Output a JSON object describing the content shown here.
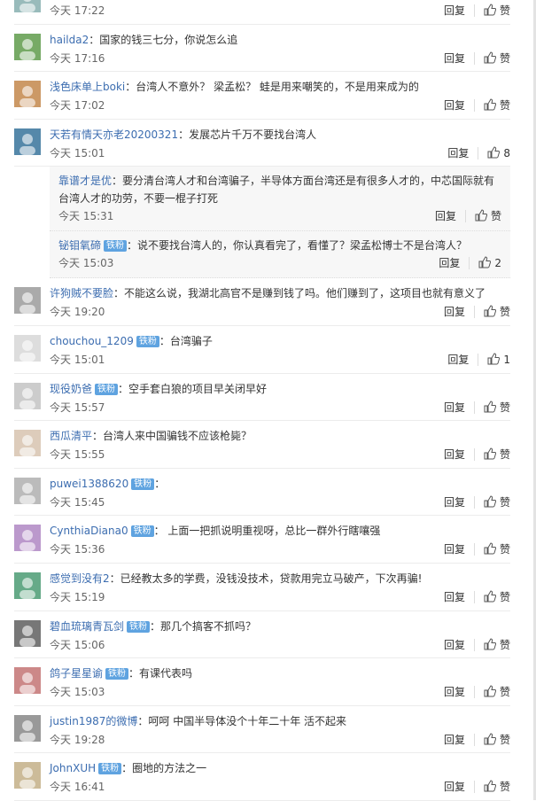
{
  "ui": {
    "reply_label": "回复",
    "like_label": "赞"
  },
  "comments": [
    {
      "user": "",
      "badge": "",
      "text": "",
      "time": "今天 17:22",
      "likes": ""
    },
    {
      "user": "hailda2",
      "badge": "",
      "text": "：国家的钱三七分，你说怎么追",
      "time": "今天 17:16",
      "likes": ""
    },
    {
      "user": "浅色床单上boki",
      "badge": "",
      "text": "：台湾人不意外？ 梁孟松？ 蛙是用来嘲笑的，不是用来成为的",
      "time": "今天 17:02",
      "likes": ""
    },
    {
      "user": "天若有情天亦老20200321",
      "badge": "",
      "text": "：发展芯片千万不要找台湾人",
      "time": "今天 15:01",
      "likes": "8"
    },
    {
      "user": "许狗贼不要脸",
      "badge": "",
      "text": "：不能这么说，我湖北高官不是赚到钱了吗。他们赚到了，这项目也就有意义了",
      "time": "今天 19:20",
      "likes": ""
    },
    {
      "user": "chouchou_1209",
      "badge": "铁粉",
      "text": "：台湾骗子",
      "time": "今天 15:01",
      "likes": "1"
    },
    {
      "user": "现役奶爸",
      "badge": "铁粉",
      "text": "：空手套白狼的项目早关闭早好",
      "time": "今天 15:57",
      "likes": ""
    },
    {
      "user": "西瓜清平",
      "badge": "",
      "text": "：台湾人来中国骗钱不应该枪毙？",
      "time": "今天 15:55",
      "likes": ""
    },
    {
      "user": "puwei1388620",
      "badge": "铁粉",
      "text": "：",
      "time": "今天 15:45",
      "likes": ""
    },
    {
      "user": "CynthiaDiana0",
      "badge": "铁粉",
      "text": "： 上面一把抓说明重视呀，总比一群外行瞎嚷强",
      "time": "今天 15:36",
      "likes": ""
    },
    {
      "user": "感觉到没有2",
      "badge": "",
      "text": "：已经教太多的学费，没钱没技术，贷款用完立马破产，下次再骗!",
      "time": "今天 15:19",
      "likes": ""
    },
    {
      "user": "碧血琉璃青瓦剑",
      "badge": "铁粉",
      "text": "：那几个搞客不抓吗？",
      "time": "今天 15:06",
      "likes": ""
    },
    {
      "user": "鸽子星星谕",
      "badge": "铁粉",
      "text": "：有课代表吗",
      "time": "今天 15:03",
      "likes": ""
    },
    {
      "user": "justin1987的微博",
      "badge": "",
      "text": "：呵呵 中国半导体没个十年二十年 活不起来",
      "time": "今天 19:28",
      "likes": ""
    },
    {
      "user": "JohnXUH",
      "badge": "铁粉",
      "text": "：圈地的方法之一",
      "time": "今天 16:41",
      "likes": ""
    }
  ],
  "replies": [
    {
      "user": "靠谱才是优",
      "badge": "",
      "text": "：要分清台湾人才和台湾骗子，半导体方面台湾还是有很多人才的，中芯国际就有台湾人才的功劳，不要一棍子打死",
      "time": "今天 15:31",
      "likes": ""
    },
    {
      "user": "铋钼氧碲",
      "badge": "铁粉",
      "text": "：说不要找台湾人的，你认真看完了，看懂了？梁孟松博士不是台湾人？",
      "time": "今天 15:03",
      "likes": "2"
    }
  ],
  "colors": {
    "link": "#3c6db0",
    "badge": "#5fa3e0"
  }
}
